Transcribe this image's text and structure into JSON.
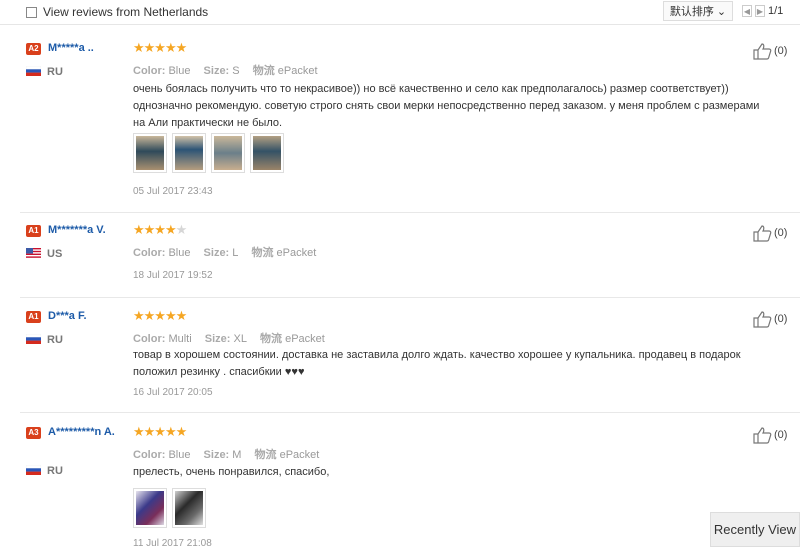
{
  "filter": {
    "label": "View reviews from Netherlands"
  },
  "sort": {
    "label": "默认排序"
  },
  "pager": {
    "prev": "◀",
    "next": "▶",
    "page": "1/1"
  },
  "labels": {
    "color": "Color:",
    "size": "Size:",
    "shipping": "物流"
  },
  "reviews": [
    {
      "badge": "A2",
      "name": "M*****a ..",
      "country": "RU",
      "flag": "ru",
      "rating": 5,
      "color": "Blue",
      "size": "S",
      "shipping": "ePacket",
      "text": "очень боялась получить что то некрасивое)) но всё качественно и село как предполагалось) размер соответствует)) однозначно рекомендую. советую строго снять свои мерки непосредственно перед заказом. у меня проблем с размерами на Али практически не было.",
      "photos": 4,
      "date": "05 Jul 2017 23:43",
      "helpful": "(0)"
    },
    {
      "badge": "A1",
      "name": "M*******a V.",
      "country": "US",
      "flag": "us",
      "rating": 4,
      "color": "Blue",
      "size": "L",
      "shipping": "ePacket",
      "text": "",
      "photos": 0,
      "date": "18 Jul 2017 19:52",
      "helpful": "(0)"
    },
    {
      "badge": "A1",
      "name": "D***a F.",
      "country": "RU",
      "flag": "ru",
      "rating": 5,
      "color": "Multi",
      "size": "XL",
      "shipping": "ePacket",
      "text": "товар в хорошем состоянии. доставка не заставила долго ждать. качество хорошее у купальника. продавец в подарок положил резинку . спасибкии ♥♥♥",
      "photos": 0,
      "date": "16 Jul 2017 20:05",
      "helpful": "(0)"
    },
    {
      "badge": "A3",
      "name": "A*********n A.",
      "country": "RU",
      "flag": "ru",
      "rating": 5,
      "color": "Blue",
      "size": "M",
      "shipping": "ePacket",
      "text": "прелесть, очень понравился, спасибо,",
      "photos": 2,
      "date": "11 Jul 2017 21:08",
      "helpful": "(0)"
    }
  ],
  "recently_viewed": {
    "label": "Recently View"
  },
  "colors": {
    "accent": "#d9401c",
    "star": "#f5a623",
    "link": "#1d5ba8"
  }
}
